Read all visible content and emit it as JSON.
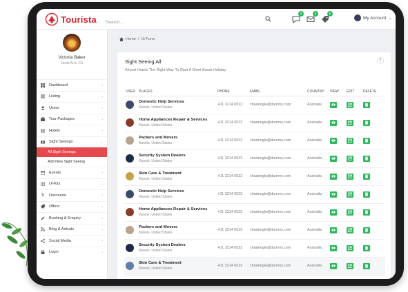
{
  "brand": {
    "name": "Tourista",
    "color": "#d6262f"
  },
  "search": {
    "placeholder": "Search..."
  },
  "header": {
    "badges": [
      "5",
      "5",
      "5"
    ],
    "account_label": "My Account"
  },
  "profile": {
    "name": "Victoria Baker",
    "location": "Santa Ana, CA"
  },
  "sidebar": {
    "items": [
      {
        "label": "Dashboard",
        "icon": "dashboard-icon"
      },
      {
        "label": "Listing",
        "icon": "list-icon"
      },
      {
        "label": "Users",
        "icon": "user-icon"
      },
      {
        "label": "Tour Packages",
        "icon": "suitcase-icon"
      },
      {
        "label": "Hotels",
        "icon": "hotel-icon"
      },
      {
        "label": "Sight Seeings",
        "icon": "camera-icon"
      }
    ],
    "sub_items": [
      "All Sight Seeings",
      "Add New Sight Seeing"
    ],
    "items2": [
      {
        "label": "Events",
        "icon": "calendar-icon"
      },
      {
        "label": "Ui-Kits",
        "icon": "grid-icon"
      },
      {
        "label": "Discounts",
        "icon": "dollar-icon"
      },
      {
        "label": "Offers",
        "icon": "tag-icon"
      },
      {
        "label": "Booking & Enquiry",
        "icon": "pencil-icon"
      },
      {
        "label": "Blog & Articals",
        "icon": "rss-icon"
      },
      {
        "label": "Social Media",
        "icon": "share-icon"
      },
      {
        "label": "Login",
        "icon": "lock-icon"
      }
    ],
    "active_color": "#e5484d"
  },
  "breadcrumb": {
    "home": "Home",
    "separator": "/",
    "current": "Ui Form"
  },
  "card": {
    "title": "Sight Seeing All",
    "subtitle": "Airport Hotels The Right Way To Start A Short Break Holiday",
    "menu_glyph": "⋮"
  },
  "table": {
    "headers": [
      "USER",
      "PLACES",
      "PHONE",
      "EMAIL",
      "COUNTRY",
      "VIEW",
      "EDIT",
      "DELETE"
    ],
    "rows": [
      {
        "place": "Domestic Help Services",
        "location": "Illunois, United States",
        "phone": "+01 3214 6522",
        "email": "chadengle@dummy.com",
        "country": "Australia",
        "avatar_color": "#3a4a6b"
      },
      {
        "place": "Home Appliances Repair & Services",
        "location": "Illunois, United States",
        "phone": "+01 3214 6522",
        "email": "chadengle@dummy.com",
        "country": "Australia",
        "avatar_color": "#8a3b2b"
      },
      {
        "place": "Packers and Movers",
        "location": "Illunois, United States",
        "phone": "+01 3214 6522",
        "email": "chadengle@dummy.com",
        "country": "Australia",
        "avatar_color": "#b8a48a"
      },
      {
        "place": "Security System Dealers",
        "location": "Illunois, United States",
        "phone": "+01 3214 6522",
        "email": "chadengle@dummy.com",
        "country": "Australia",
        "avatar_color": "#1f2a44"
      },
      {
        "place": "Skin Care & Treatment",
        "location": "Illunois, United States",
        "phone": "+01 3214 6522",
        "email": "chadengle@dummy.com",
        "country": "Australia",
        "avatar_color": "#c7a14a"
      },
      {
        "place": "Domestic Help Services",
        "location": "Illunois, United States",
        "phone": "+01 3214 6522",
        "email": "chadengle@dummy.com",
        "country": "Australia",
        "avatar_color": "#3a4a6b"
      },
      {
        "place": "Home Appliances Repair & Services",
        "location": "Illunois, United States",
        "phone": "+01 3214 6522",
        "email": "chadengle@dummy.com",
        "country": "Australia",
        "avatar_color": "#8a3b2b"
      },
      {
        "place": "Packers and Movers",
        "location": "Illunois, United States",
        "phone": "+01 3214 6522",
        "email": "chadengle@dummy.com",
        "country": "Australia",
        "avatar_color": "#b8a48a"
      },
      {
        "place": "Security System Dealers",
        "location": "Illunois, United States",
        "phone": "+01 3214 6522",
        "email": "chadengle@dummy.com",
        "country": "Australia",
        "avatar_color": "#1f2a44"
      },
      {
        "place": "Skin Care & Treatment",
        "location": "Illunois, United States",
        "phone": "+01 3214 6522",
        "email": "chadengle@dummy.com",
        "country": "Australia",
        "avatar_color": "#5f7fa6"
      }
    ]
  },
  "action_color": "#2eb85c"
}
